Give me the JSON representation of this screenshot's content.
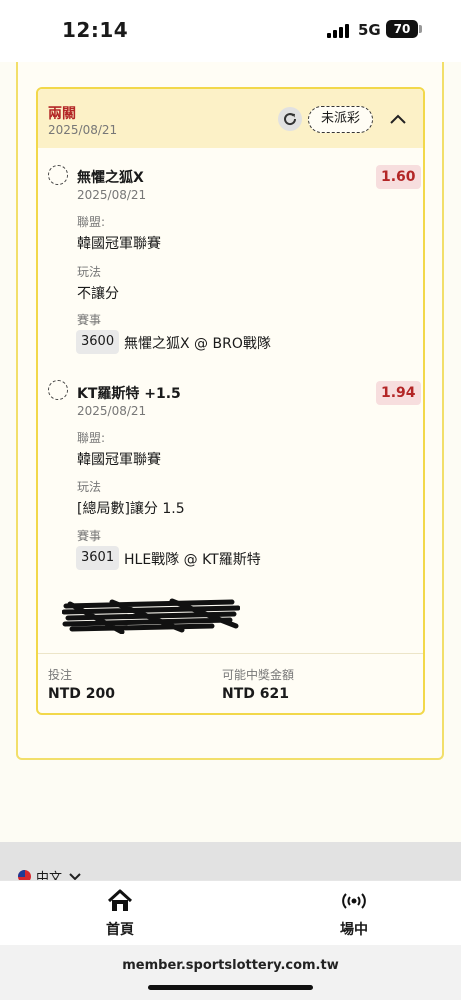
{
  "status_bar": {
    "time": "12:14",
    "network": "5G",
    "battery": "70"
  },
  "bet": {
    "type": "兩關",
    "date": "2025/08/21",
    "status": "未派彩",
    "legs": [
      {
        "selection": "無懼之狐X",
        "date": "2025/08/21",
        "odds": "1.60",
        "league_label": "聯盟:",
        "league": "韓國冠軍聯賽",
        "market_label": "玩法",
        "market": "不讓分",
        "event_label": "賽事",
        "event_id": "3600",
        "event_name": "無懼之狐X @ BRO戰隊"
      },
      {
        "selection": "KT羅斯特 +1.5",
        "date": "2025/08/21",
        "odds": "1.94",
        "league_label": "聯盟:",
        "league": "韓國冠軍聯賽",
        "market_label": "玩法",
        "market": "[總局數]讓分 1.5",
        "event_label": "賽事",
        "event_id": "3601",
        "event_name": "HLE戰隊 @ KT羅斯特"
      }
    ],
    "stake_label": "投注",
    "stake": "NTD 200",
    "payout_label": "可能中獎金額",
    "payout": "NTD 621"
  },
  "language": "中文",
  "tabs": [
    {
      "label": "首頁",
      "icon": "home-icon"
    },
    {
      "label": "場中",
      "icon": "live-broadcast-icon"
    }
  ],
  "url": "member.sportslottery.com.tw",
  "colors": {
    "accent_red": "#b32626",
    "card_border": "#f2d84a",
    "header_bg": "#fcf1c7"
  }
}
